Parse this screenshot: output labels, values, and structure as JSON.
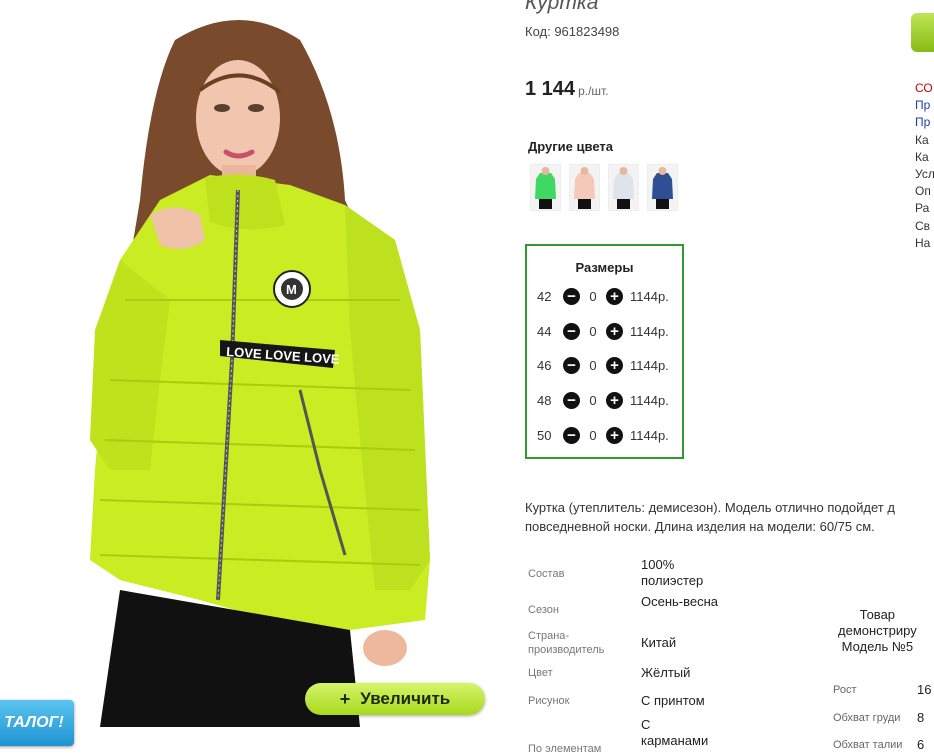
{
  "product": {
    "title": "Куртка",
    "code": "Код: 961823498",
    "price": "1 144",
    "price_unit": "р./шт."
  },
  "photo": {
    "zoom_label": "Увеличить",
    "zoom_icon": "plus-icon",
    "catalog_tab": "ТАЛОГ!"
  },
  "other_colors": {
    "title": "Другие цвета",
    "swatches": [
      {
        "color": "#3fd862",
        "name": "green"
      },
      {
        "color": "#f4c9ba",
        "name": "peach"
      },
      {
        "color": "#dfe3ea",
        "name": "white"
      },
      {
        "color": "#2f4f95",
        "name": "blue"
      }
    ]
  },
  "sizes": {
    "title": "Размеры",
    "minus_icon": "minus-icon",
    "plus_icon": "plus-icon",
    "rows": [
      {
        "size": "42",
        "qty": "0",
        "price": "1144р."
      },
      {
        "size": "44",
        "qty": "0",
        "price": "1144р."
      },
      {
        "size": "46",
        "qty": "0",
        "price": "1144р."
      },
      {
        "size": "48",
        "qty": "0",
        "price": "1144р."
      },
      {
        "size": "50",
        "qty": "0",
        "price": "1144р."
      }
    ]
  },
  "right_column": [
    "СО",
    "Пр",
    "Пр",
    "Ка",
    "Ка",
    "Усл",
    "Оп",
    "Ра",
    "Св",
    "На"
  ],
  "description": {
    "line1": "Куртка (утеплитель: демисезон). Модель отлично подойдет д",
    "line2": "повседневной носки. Длина изделия на модели: 60/75 см."
  },
  "properties": [
    {
      "label": "Состав",
      "value": "100% полиэстер"
    },
    {
      "label": "Сезон",
      "value": "Осень-весна"
    },
    {
      "label": "Страна-производитель",
      "value": "Китай"
    },
    {
      "label": "Цвет",
      "value": "Жёлтый"
    },
    {
      "label": "Рисунок",
      "value": "С принтом"
    },
    {
      "label": "По элементам",
      "value": "С карманами"
    }
  ],
  "model": {
    "line1": "Товар",
    "line2": "демонстриру",
    "line3": "Модель №5",
    "measurements": [
      {
        "label": "Рост",
        "value": "16"
      },
      {
        "label": "Обхват груди",
        "value": "8"
      },
      {
        "label": "Обхват талии",
        "value": "6"
      }
    ]
  },
  "colors": {
    "jacket": "#c9ec22",
    "sizes_border": "#2e9b2e",
    "zoom_button": "#b6e232",
    "catalog_tab": "#2aa0db"
  }
}
